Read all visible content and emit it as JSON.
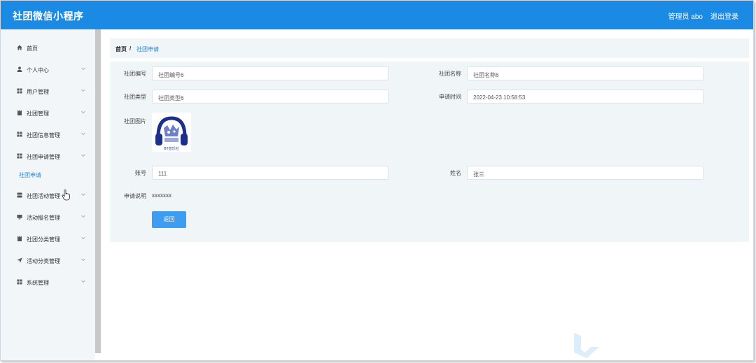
{
  "app": {
    "title": "社团微信小程序"
  },
  "header": {
    "admin_label": "管理员 abo",
    "logout_label": "退出登录"
  },
  "sidebar": {
    "items": [
      {
        "label": "首页",
        "icon": "home-icon",
        "has_arrow": false
      },
      {
        "label": "个人中心",
        "icon": "user-icon",
        "has_arrow": true
      },
      {
        "label": "用户管理",
        "icon": "grid-icon",
        "has_arrow": true
      },
      {
        "label": "社团管理",
        "icon": "clipboard-icon",
        "has_arrow": true
      },
      {
        "label": "社团信息管理",
        "icon": "grid-icon",
        "has_arrow": true
      },
      {
        "label": "社团申请管理",
        "icon": "grid-icon",
        "has_arrow": true
      },
      {
        "label": "社团活动管理",
        "icon": "server-icon",
        "has_arrow": true
      },
      {
        "label": "活动报名管理",
        "icon": "monitor-icon",
        "has_arrow": true
      },
      {
        "label": "社团分类管理",
        "icon": "clipboard-icon",
        "has_arrow": true
      },
      {
        "label": "活动分类管理",
        "icon": "send-icon",
        "has_arrow": true
      },
      {
        "label": "系统管理",
        "icon": "grid-icon",
        "has_arrow": true
      }
    ],
    "sub_item": "社团申请"
  },
  "breadcrumb": {
    "home": "首页",
    "separator": "/",
    "current": "社团申请"
  },
  "form": {
    "club_no_label": "社团编号",
    "club_no_value": "社团编号6",
    "club_name_label": "社团名称",
    "club_name_value": "社团名称6",
    "club_type_label": "社团类型",
    "club_type_value": "社团类型6",
    "apply_time_label": "申请时间",
    "apply_time_value": "2022-04-23 10:58:53",
    "club_image_label": "社团图片",
    "club_image_caption": "BT音乐社",
    "account_label": "账号",
    "account_value": "111",
    "name_label": "姓名",
    "name_value": "张三",
    "desc_label": "申请说明",
    "desc_value": "xxxxxxx",
    "return_label": "返回"
  },
  "colors": {
    "primary": "#1a8ae5",
    "button": "#3d9df0",
    "panel": "#f0f5f8",
    "sidebar": "#f3f6f9"
  }
}
